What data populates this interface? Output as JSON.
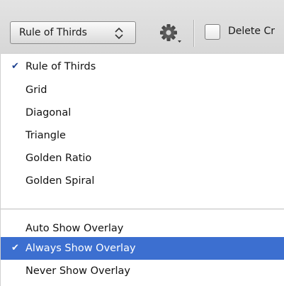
{
  "toolbar": {
    "overlay_select_value": "Rule of Thirds",
    "delete_cropped_label": "Delete Cr",
    "delete_cropped_checked": false
  },
  "menu": {
    "check_mark": "✔",
    "overlay_types": [
      {
        "label": "Rule of Thirds",
        "checked": true
      },
      {
        "label": "Grid",
        "checked": false
      },
      {
        "label": "Diagonal",
        "checked": false
      },
      {
        "label": "Triangle",
        "checked": false
      },
      {
        "label": "Golden Ratio",
        "checked": false
      },
      {
        "label": "Golden Spiral",
        "checked": false
      }
    ],
    "overlay_modes": [
      {
        "label": "Auto Show Overlay",
        "checked": false
      },
      {
        "label": "Always Show Overlay",
        "checked": true,
        "highlighted": true
      },
      {
        "label": "Never Show Overlay",
        "checked": false
      }
    ]
  },
  "colors": {
    "highlight": "#3c6fd0",
    "toolbar_bg": "#dddddd"
  },
  "icons": {
    "stepper": "up-down-arrows-icon",
    "gear": "gear-icon"
  }
}
